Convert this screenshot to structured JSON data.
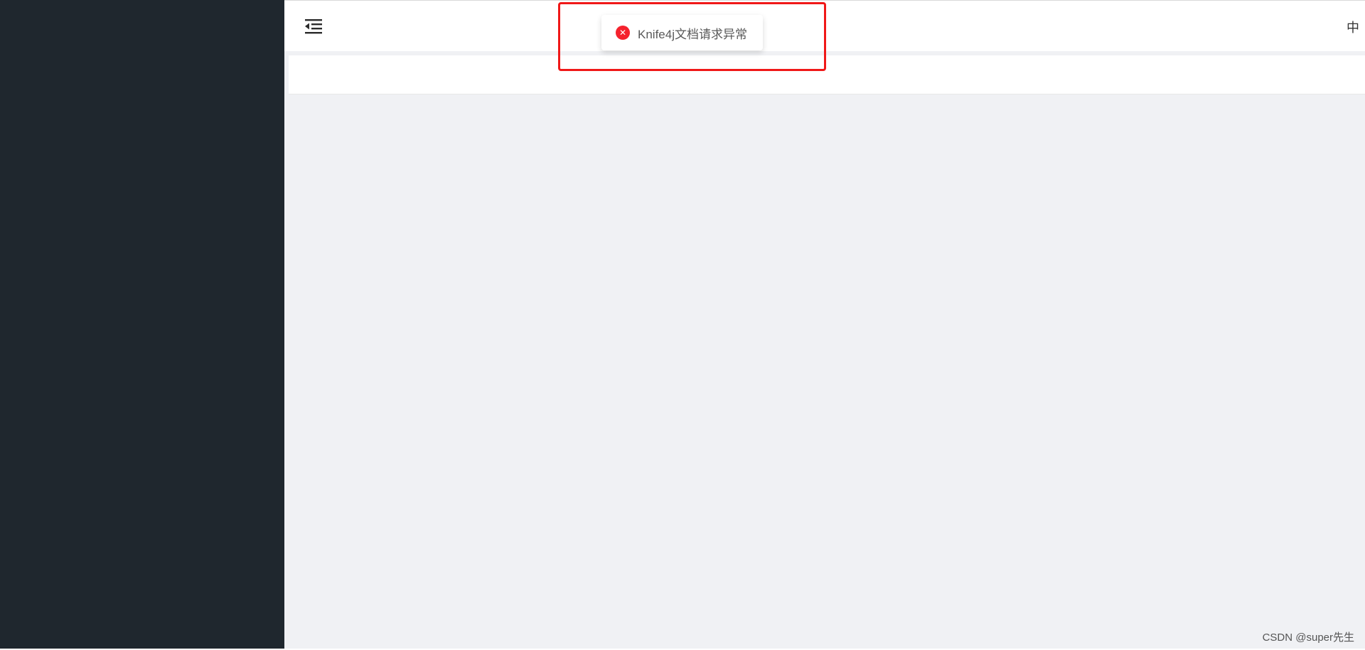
{
  "header": {
    "menu_toggle_icon": "menu-fold-icon",
    "lang_switch": "中"
  },
  "message": {
    "type": "error",
    "icon": "close-circle-icon",
    "text": "Knife4j文档请求异常"
  },
  "watermark": "CSDN @super先生",
  "colors": {
    "sidebar": "#1f272e",
    "content_bg": "#f0f1f4",
    "error": "#f5222d",
    "highlight_border": "#f01818"
  }
}
